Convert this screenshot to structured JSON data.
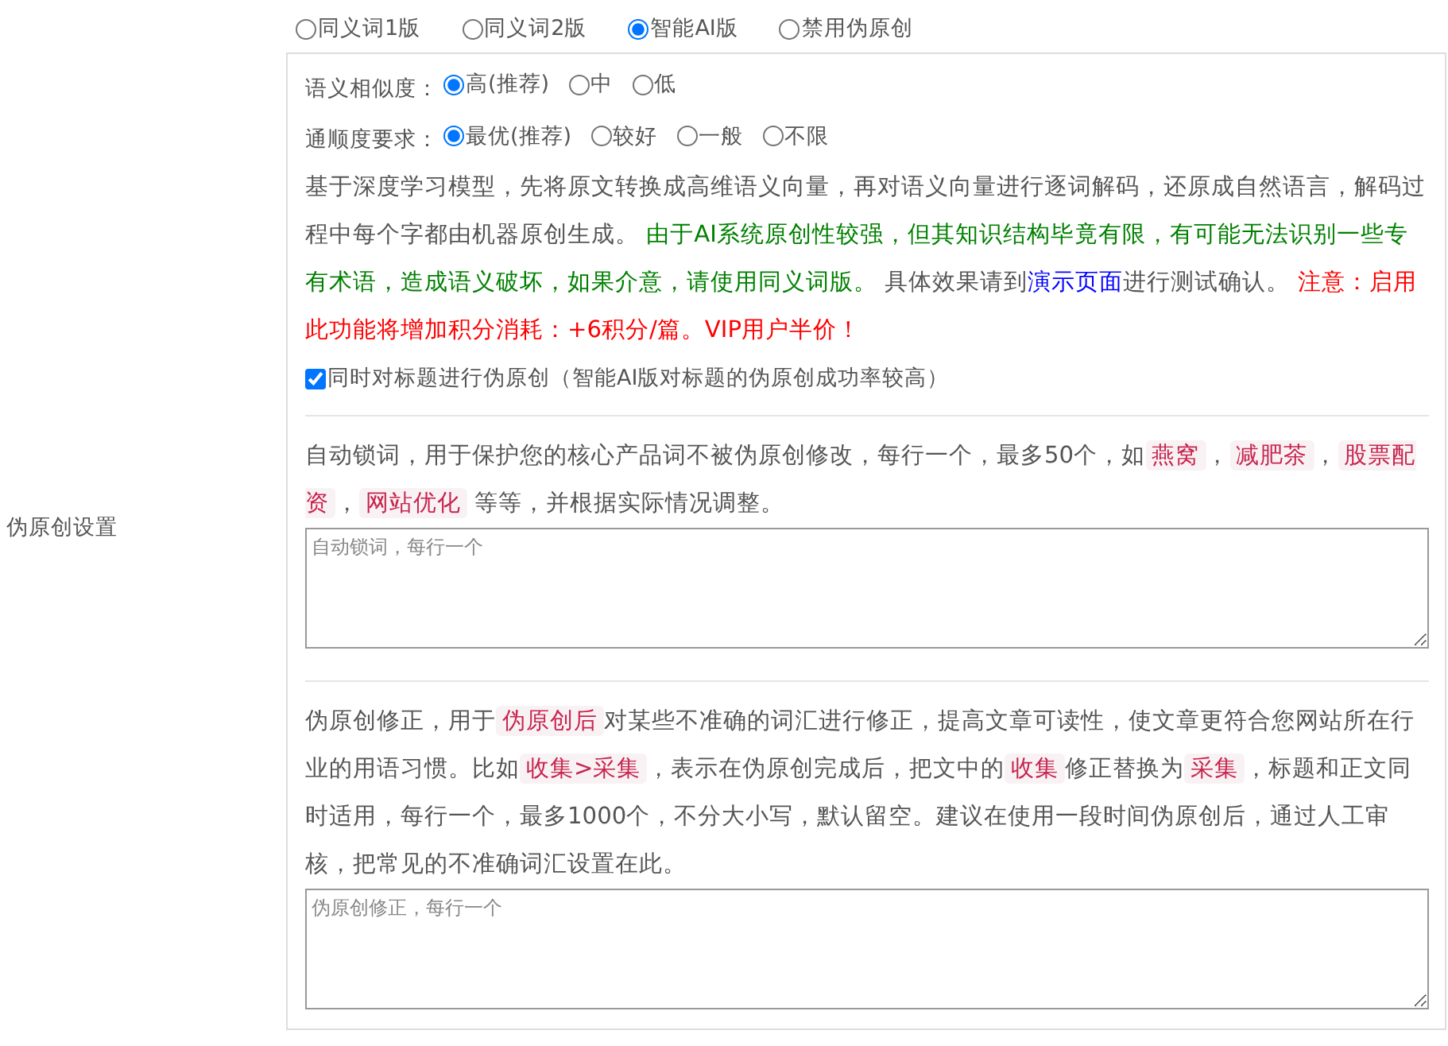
{
  "mode_options": [
    {
      "label": "同义词1版",
      "selected": false
    },
    {
      "label": "同义词2版",
      "selected": false
    },
    {
      "label": "智能AI版",
      "selected": true
    },
    {
      "label": "禁用伪原创",
      "selected": false
    }
  ],
  "ai_settings": {
    "similarity": {
      "label": "语义相似度：",
      "options": [
        {
          "label": "高(推荐)",
          "selected": true
        },
        {
          "label": "中",
          "selected": false
        },
        {
          "label": "低",
          "selected": false
        }
      ]
    },
    "fluency": {
      "label": "通顺度要求：",
      "options": [
        {
          "label": "最优(推荐)",
          "selected": true
        },
        {
          "label": "较好",
          "selected": false
        },
        {
          "label": "一般",
          "selected": false
        },
        {
          "label": "不限",
          "selected": false
        }
      ]
    },
    "description": [
      {
        "kind": "text",
        "text": "基于深度学习模型，先将原文转换成高维语义向量，再对语义向量进行逐词解码，还原成自然语言，解码过程中每个字都由机器原创生成。 "
      },
      {
        "kind": "note",
        "text": "由于AI系统原创性较强，但其知识结构毕竟有限，有可能无法识别一些专有术语，造成语义破坏，如果介意，请使用同义词版。"
      },
      {
        "kind": "text",
        "text": " 具体效果请到"
      },
      {
        "kind": "link",
        "text": "演示页面"
      },
      {
        "kind": "text",
        "text": "进行测试确认。 "
      },
      {
        "kind": "warning",
        "text": "注意：启用此功能将增加积分消耗：+6积分/篇。VIP用户半价！"
      }
    ],
    "title_checkbox": {
      "label": "同时对标题进行伪原创（智能AI版对标题的伪原创成功率较高）",
      "checked": true
    }
  },
  "lock_words": {
    "label": "伪原创设置",
    "description": [
      {
        "kind": "text",
        "text": "自动锁词，用于保护您的核心产品词不被伪原创修改，每行一个，最多50个，如"
      },
      {
        "kind": "tag",
        "text": "燕窝"
      },
      {
        "kind": "text",
        "text": "，"
      },
      {
        "kind": "tag",
        "text": "减肥茶"
      },
      {
        "kind": "text",
        "text": "，"
      },
      {
        "kind": "tag",
        "text": "股票配资"
      },
      {
        "kind": "text",
        "text": "，"
      },
      {
        "kind": "tag",
        "text": "网站优化"
      },
      {
        "kind": "text",
        "text": " 等等，并根据实际情况调整。"
      }
    ],
    "placeholder": "自动锁词，每行一个"
  },
  "correction": {
    "description": [
      {
        "kind": "text",
        "text": "伪原创修正，用于"
      },
      {
        "kind": "tag",
        "text": "伪原创后"
      },
      {
        "kind": "text",
        "text": "对某些不准确的词汇进行修正，提高文章可读性，使文章更符合您网站所在行业的用语习惯。比如"
      },
      {
        "kind": "tag",
        "text": "收集>采集"
      },
      {
        "kind": "text",
        "text": "，表示在伪原创完成后，把文中的"
      },
      {
        "kind": "tag",
        "text": "收集"
      },
      {
        "kind": "text",
        "text": "修正替换为"
      },
      {
        "kind": "tag",
        "text": "采集"
      },
      {
        "kind": "text",
        "text": "，标题和正文同时适用，每行一个，最多1000个，不分大小写，默认留空。建议在使用一段时间伪原创后，通过人工审核，把常见的不准确词汇设置在此。"
      }
    ],
    "placeholder": "伪原创修正，每行一个"
  }
}
